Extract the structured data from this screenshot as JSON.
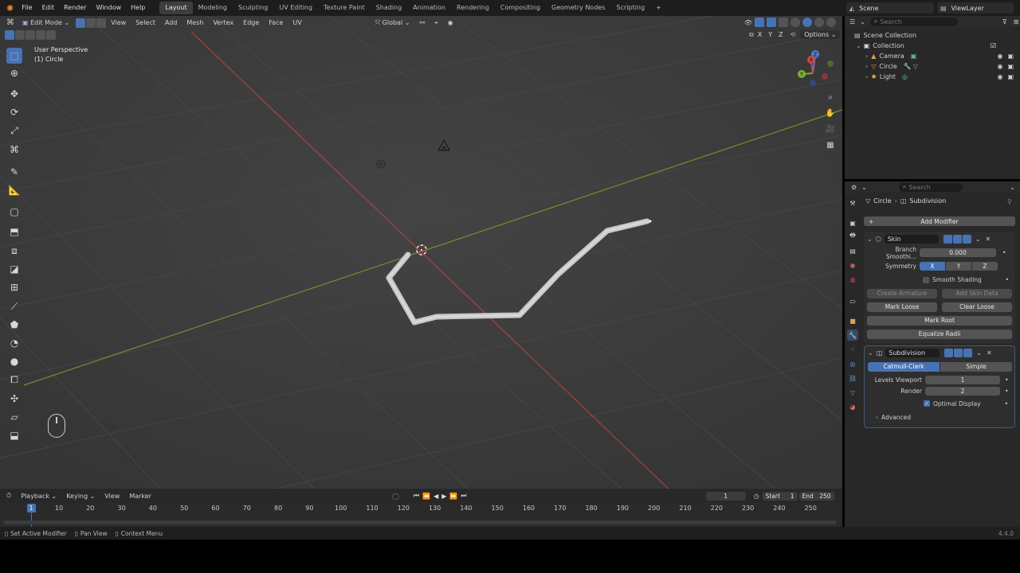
{
  "menubar": {
    "items": [
      "File",
      "Edit",
      "Render",
      "Window",
      "Help"
    ],
    "workspaces": [
      "Layout",
      "Modeling",
      "Sculpting",
      "UV Editing",
      "Texture Paint",
      "Shading",
      "Animation",
      "Rendering",
      "Compositing",
      "Geometry Nodes",
      "Scripting"
    ],
    "active_workspace": "Layout",
    "add_tab": "+",
    "scene": "Scene",
    "view_layer": "ViewLayer"
  },
  "viewport_header": {
    "mode": "Edit Mode",
    "menus": [
      "View",
      "Select",
      "Add",
      "Mesh",
      "Vertex",
      "Edge",
      "Face",
      "UV"
    ],
    "transform_orientation": "Global",
    "axes": [
      "X",
      "Y",
      "Z"
    ],
    "options": "Options"
  },
  "viewport": {
    "perspective": "User Perspective",
    "object": "(1) Circle",
    "gizmo": {
      "x": "X",
      "y": "Y",
      "z": "Z"
    }
  },
  "outliner": {
    "search_placeholder": "Search",
    "root": "Scene Collection",
    "collection": "Collection",
    "objects": [
      "Camera",
      "Circle",
      "Light"
    ]
  },
  "properties": {
    "search_placeholder": "Search",
    "breadcrumb_object": "Circle",
    "breadcrumb_modifier": "Subdivision",
    "add_modifier": "Add Modifier",
    "skin": {
      "name": "Skin",
      "branch_label": "Branch Smoothi...",
      "branch_value": "0.000",
      "symmetry_label": "Symmetry",
      "symmetry": [
        "X",
        "Y",
        "Z"
      ],
      "smooth_shading": "Smooth Shading",
      "create_armature": "Create Armature",
      "add_skin_data": "Add Skin Data",
      "mark_loose": "Mark Loose",
      "clear_loose": "Clear Loose",
      "mark_root": "Mark Root",
      "equalize_radii": "Equalize Radii"
    },
    "subdivision": {
      "name": "Subdivision",
      "catmull": "Catmull-Clark",
      "simple": "Simple",
      "levels_viewport_label": "Levels Viewport",
      "levels_viewport": "1",
      "render_label": "Render",
      "render": "2",
      "optimal_display": "Optimal Display",
      "advanced": "Advanced"
    }
  },
  "timeline": {
    "menus": [
      "Playback",
      "Keying",
      "View",
      "Marker"
    ],
    "current_frame": "1",
    "start_label": "Start",
    "start": "1",
    "end_label": "End",
    "end": "250",
    "ruler": [
      "1",
      "10",
      "20",
      "30",
      "40",
      "50",
      "60",
      "70",
      "80",
      "90",
      "100",
      "110",
      "120",
      "130",
      "140",
      "150",
      "160",
      "170",
      "180",
      "190",
      "200",
      "210",
      "220",
      "230",
      "240",
      "250"
    ]
  },
  "statusbar": {
    "left": "Set Active Modifier",
    "middle": "Pan View",
    "right": "Context Menu",
    "version": "4.4.0"
  },
  "colors": {
    "accent": "#4772b3",
    "x_axis": "#d04545",
    "y_axis": "#7bb132",
    "z_axis": "#4a7dd6"
  }
}
